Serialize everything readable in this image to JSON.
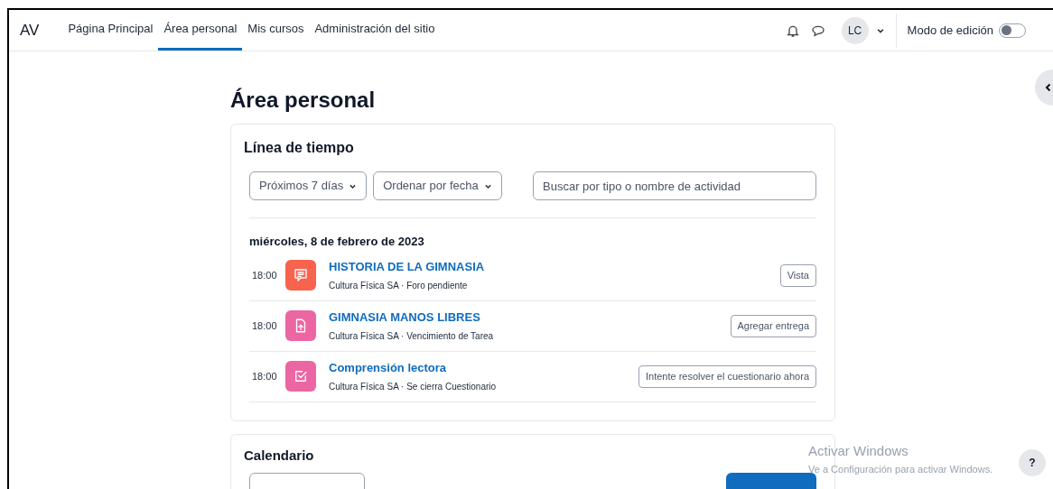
{
  "navbar": {
    "brand": "AV",
    "links": [
      {
        "label": "Página Principal",
        "selected": false
      },
      {
        "label": "Área personal",
        "selected": true
      },
      {
        "label": "Mis cursos",
        "selected": false
      },
      {
        "label": "Administración del sitio",
        "selected": false
      }
    ],
    "avatar": "LC",
    "edit_mode": {
      "label": "Modo de edición",
      "on": false
    }
  },
  "page_title": "Área personal",
  "timeline": {
    "title": "Línea de tiempo",
    "filters": [
      "Próximos 7 días",
      "Ordenar por fecha"
    ],
    "search": {
      "placeholder": "Buscar por tipo o nombre de actividad"
    },
    "date": "miércoles, 8 de febrero de 2023",
    "events": [
      {
        "time": "18:00",
        "kind": "forum",
        "color": "#f7634d",
        "title": "HISTORIA DE LA GIMNASIA",
        "subtitle": "Cultura Física SA · Foro pendiente",
        "action": "Vista"
      },
      {
        "time": "18:00",
        "kind": "assign",
        "color": "#eb66a2",
        "title": "GIMNASIA MANOS LIBRES",
        "subtitle": "Cultura Física SA · Vencimiento de Tarea",
        "action": "Agregar entrega"
      },
      {
        "time": "18:00",
        "kind": "quiz",
        "color": "#eb66a2",
        "title": "Comprensión lectora",
        "subtitle": "Cultura Física SA · Se cierra Cuestionario",
        "action": "Intente resolver el cuestionario ahora"
      }
    ]
  },
  "calendar": {
    "title": "Calendario"
  },
  "windows_notice": {
    "title": "Activar Windows",
    "subtitle": "Ve a Configuración para activar Windows."
  },
  "help_button": "?"
}
